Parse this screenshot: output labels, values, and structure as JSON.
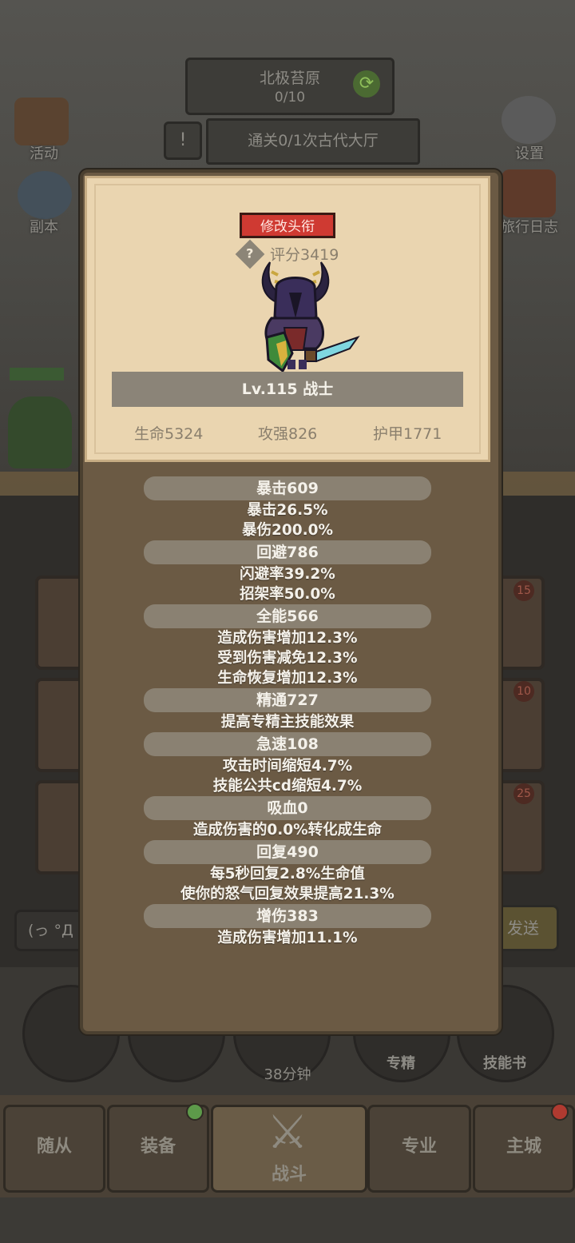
{
  "background": {
    "quest": {
      "name": "北极苔原",
      "progress": "0/10"
    },
    "task": "通关0/1次古代大厅",
    "left_icons": [
      "活动",
      "副本"
    ],
    "right_icons": [
      "设置",
      "旅行日志"
    ],
    "card_badges": [
      "15",
      "10",
      "25"
    ],
    "chat_input": "(っ °Д °",
    "send_label": "发送",
    "timer": "38分钟",
    "round_buttons": [
      "专精",
      "技能书"
    ]
  },
  "nav": {
    "items": [
      {
        "label": "随从",
        "active": false
      },
      {
        "label": "装备",
        "active": false,
        "badge": "green"
      },
      {
        "label": "战斗",
        "active": true
      },
      {
        "label": "专业",
        "active": false
      },
      {
        "label": "主城",
        "active": false,
        "badge": "red"
      }
    ]
  },
  "profile": {
    "rename_button": "修改头衔",
    "score": "评分3419",
    "level": "Lv.115 战士",
    "hp": "生命5324",
    "attack": "攻强826",
    "armor": "护甲1771"
  },
  "stats": [
    {
      "header": "暴击609",
      "lines": [
        "暴击26.5%",
        "暴伤200.0%"
      ]
    },
    {
      "header": "回避786",
      "lines": [
        "闪避率39.2%",
        "招架率50.0%"
      ]
    },
    {
      "header": "全能566",
      "lines": [
        "造成伤害增加12.3%",
        "受到伤害减免12.3%",
        "生命恢复增加12.3%"
      ]
    },
    {
      "header": "精通727",
      "lines": [
        "提高专精主技能效果"
      ]
    },
    {
      "header": "急速108",
      "lines": [
        "攻击时间缩短4.7%",
        "技能公共cd缩短4.7%"
      ]
    },
    {
      "header": "吸血0",
      "lines": [
        "造成伤害的0.0%转化成生命"
      ]
    },
    {
      "header": "回复490",
      "lines": [
        "每5秒回复2.8%生命值",
        "使你的怒气回复效果提高21.3%"
      ]
    },
    {
      "header": "增伤383",
      "lines": [
        "造成伤害增加11.1%"
      ]
    }
  ],
  "colors": {
    "rename_button": "#cf3a32",
    "parchment": "#ead5b0",
    "modal_body": "#6b5a44",
    "stat_header": "#8a8172"
  }
}
